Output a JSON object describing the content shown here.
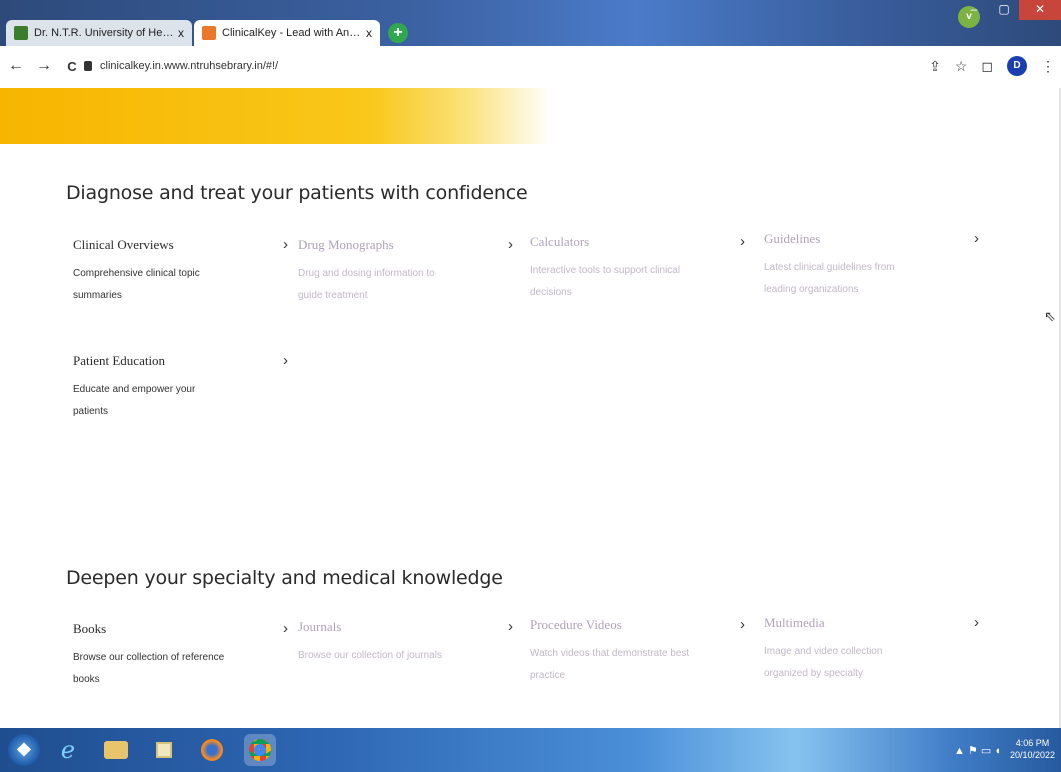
{
  "browser": {
    "tabs": [
      {
        "title": "Dr. N.T.R. University of Health Sc",
        "close": "x"
      },
      {
        "title": "ClinicalKey - Lead with Answers",
        "close": "x"
      }
    ],
    "new_tab": "+",
    "profile_dropdown": "v",
    "window_controls": {
      "minimize": "–",
      "maximize": "▢",
      "close": "✕"
    },
    "nav": {
      "back": "←",
      "forward": "→",
      "reload": "C"
    },
    "url": "clinicalkey.in.www.ntruhsebrary.in/#!/",
    "profile_avatar": "D",
    "toolbar_icons": {
      "share": "⇪",
      "bookmark": "☆",
      "sidepanel": "◻",
      "menu": "⋮"
    }
  },
  "page": {
    "colors": {
      "banner_start": "#f7b500",
      "banner_end": "#ffffff",
      "faded_text": "#b0a3b8"
    },
    "section1": {
      "title": "Diagnose and treat your patients with confidence",
      "cards": [
        {
          "label": "Clinical Overviews",
          "desc": "Comprehensive clinical topic summaries",
          "chevron": "›"
        },
        {
          "label": "Drug Monographs",
          "desc": "Drug and dosing information to guide treatment",
          "chevron": "›"
        },
        {
          "label": "Calculators",
          "desc": "Interactive tools to support clinical decisions",
          "chevron": "›"
        },
        {
          "label": "Guidelines",
          "desc": "Latest clinical guidelines from leading organizations",
          "chevron": "›"
        },
        {
          "label": "Patient Education",
          "desc": "Educate and empower your patients",
          "chevron": "›"
        }
      ]
    },
    "section2": {
      "title": "Deepen your specialty and medical knowledge",
      "cards": [
        {
          "label": "Books",
          "desc": "Browse our collection of reference books",
          "chevron": "›"
        },
        {
          "label": "Journals",
          "desc": "Browse our collection of journals",
          "chevron": "›"
        },
        {
          "label": "Procedure Videos",
          "desc": "Watch videos that demonstrate best practice",
          "chevron": "›"
        },
        {
          "label": "Multimedia",
          "desc": "Image and video collection organized by specialty",
          "chevron": "›"
        }
      ]
    }
  },
  "taskbar": {
    "start": "❖",
    "ie": "e",
    "tray": "▲ ⚑ ▭ ◖",
    "clock_time": "4:06 PM",
    "clock_date": "20/10/2022"
  }
}
